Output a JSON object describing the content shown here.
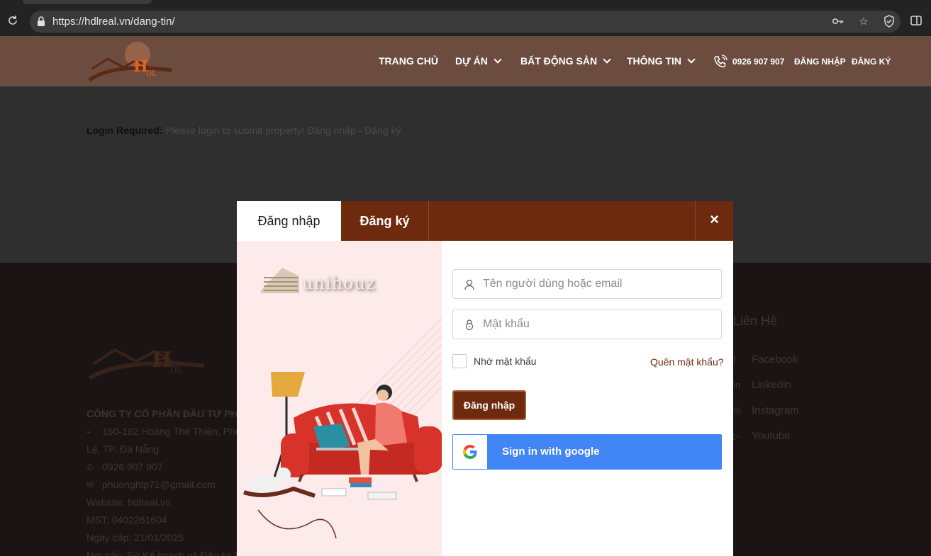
{
  "browser": {
    "url": "https://hdlreal.vn/dang-tin/",
    "icons": [
      "reload-icon",
      "lock-icon",
      "key-icon",
      "star-icon",
      "shield-icon",
      "side-panel-icon"
    ]
  },
  "header": {
    "logo_text": "HDL",
    "nav": {
      "home": "TRANG CHỦ",
      "projects": "DỰ ÁN",
      "real_estate": "BẤT ĐỘNG SẢN",
      "info": "THÔNG TIN",
      "phone": "0926 907 907",
      "login": "ĐĂNG NHẬP",
      "register": "ĐĂNG KÝ"
    }
  },
  "page": {
    "login_required_label": "Login Required:",
    "login_required_text": " Please login to submit property! Đăng nhập - Đăng ký"
  },
  "footer": {
    "company": "CÔNG TY CỔ PHẦN ĐẦU TƯ PH",
    "address_1": "160-162 Hoàng Thế Thiện, Phư",
    "address_2": "Lệ, TP. Đà Nẵng",
    "phone": "0926 907 907",
    "email": "phuonghtp71@gmail.com",
    "website": "Website: hdlreal.vn",
    "tax_id": "MST: 0402261604",
    "issue_date": "Ngày cấp: 21/01/2025",
    "issuer": "Nơi cấp: Sở Kế hoạch và Đầu tư T",
    "contact_title": "Liên Hệ",
    "contact_links": [
      "Facebook",
      "Linkedin",
      "Instagram",
      "Youtube"
    ]
  },
  "modal": {
    "tab_login": "Đăng nhập",
    "tab_register": "Đăng ký",
    "close": "×",
    "brand": "unihouz",
    "username_placeholder": "Tên người dùng hoặc email",
    "password_placeholder": "Mật khẩu",
    "remember_label": "Nhớ mật khẩu",
    "forgot_label": "Quên mật khẩu?",
    "login_button": "Đăng nhập",
    "google_button": "Sign in with google"
  },
  "colors": {
    "header_bg": "#6d4c40",
    "modal_accent": "#6d2a0e",
    "google_blue": "#4285f4"
  }
}
